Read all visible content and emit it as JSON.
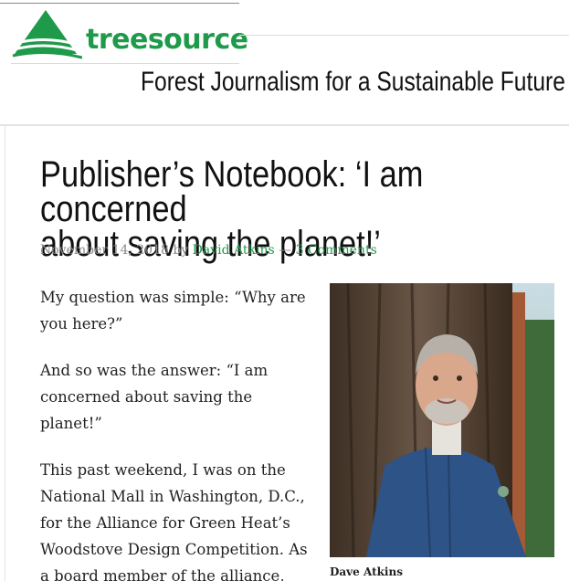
{
  "header": {
    "logo_text": "treesource",
    "tagline": "Forest Journalism for a Sustainable Future"
  },
  "article": {
    "title": "Publisher’s Notebook: ‘I am concerned\nabout saving the planet!’",
    "date": "November 14, 2018",
    "by": " by ",
    "author": "David Atkins",
    "separator": " — ",
    "comments": "3 Comments",
    "paragraphs": [
      "My question was simple: “Why are you here?”",
      "And so was the answer: “I am concerned about saving the planet!”",
      "This past weekend, I was on the National Mall in Washington, D.C., for the Alliance for Green Heat’s Woodstove Design Competition. As a board member of the alliance,"
    ],
    "photo_caption": "Dave Atkins"
  },
  "colors": {
    "brand_green": "#1e9a4a",
    "meta_gray": "#8a8a8a"
  },
  "icons": {
    "logo": "treesource-mountain-logo-icon"
  }
}
